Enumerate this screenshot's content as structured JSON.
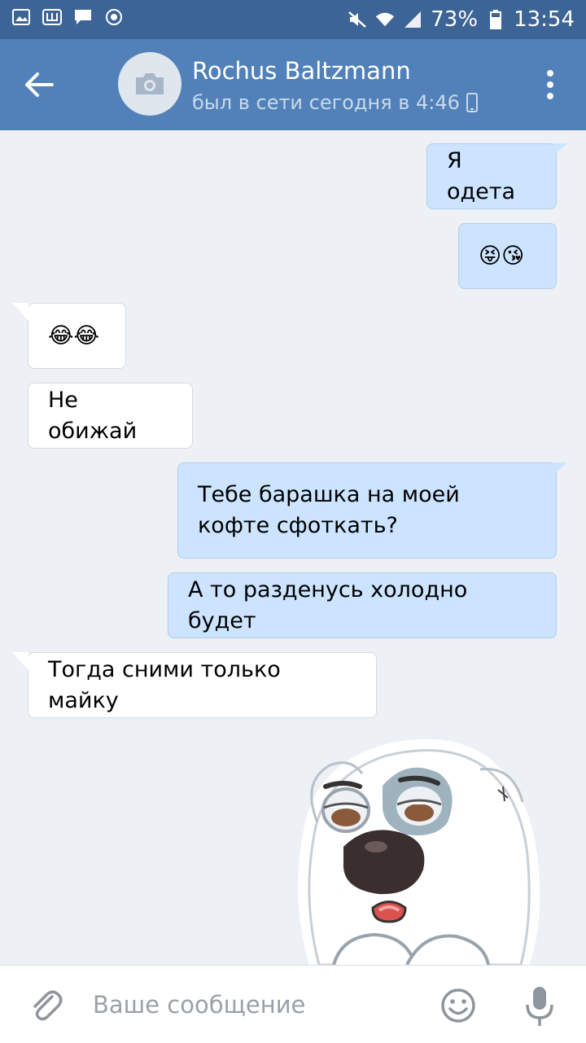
{
  "status_bar": {
    "battery": "73%",
    "time": "13:54"
  },
  "header": {
    "contact_name": "Rochus Baltzmann",
    "contact_status": "был в сети сегодня в 4:46"
  },
  "messages": [
    {
      "direction": "out",
      "text": "Я одета"
    },
    {
      "direction": "out",
      "text": "😝😘"
    },
    {
      "direction": "in",
      "text": "😂😂"
    },
    {
      "direction": "in",
      "text": "Не обижай"
    },
    {
      "direction": "out",
      "text": "Тебе барашка на моей кофте сфоткать?"
    },
    {
      "direction": "out",
      "text": "А то разденусь холодно будет"
    },
    {
      "direction": "in",
      "text": "Тогда сними только майку"
    }
  ],
  "input": {
    "placeholder": "Ваше сообщение",
    "value": ""
  },
  "colors": {
    "header": "#5181b8",
    "status_bar": "#3d6496",
    "background": "#edf0f5",
    "outgoing_bubble": "#cce4ff",
    "incoming_bubble": "#ffffff"
  },
  "icons": {
    "back": "arrow-left-icon",
    "avatar": "camera-icon",
    "menu": "more-vertical-icon",
    "attach": "paperclip-icon",
    "emoji": "smile-icon",
    "voice": "microphone-icon",
    "device": "phone-icon"
  }
}
